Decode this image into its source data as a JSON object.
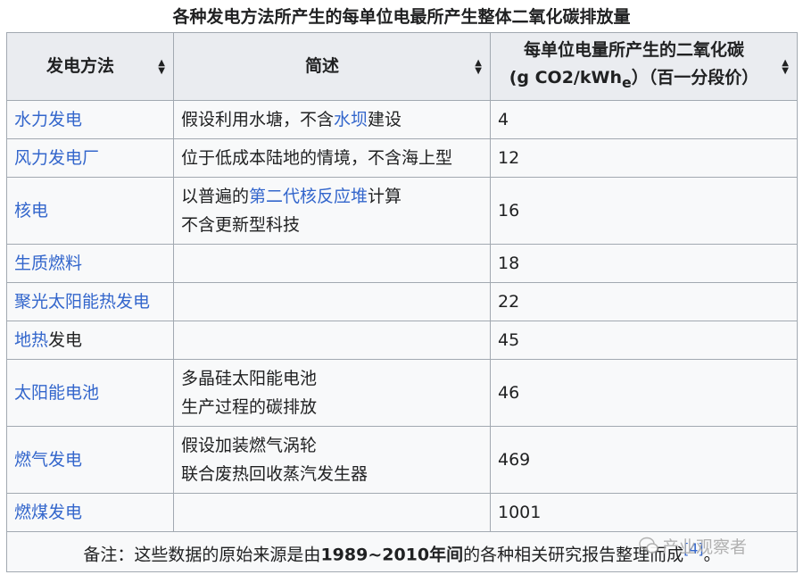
{
  "caption": "各种发电方法所产生的每单位电最所产生整体二氧化碳排放量",
  "headers": {
    "method": "发电方法",
    "description": "简述",
    "emission_line1": "每单位电量所产生的二氧化碳",
    "emission_line2_prefix": "(g CO2/kWh",
    "emission_line2_sub": "e",
    "emission_line2_suffix": "）（百一分段价）"
  },
  "rows": [
    {
      "method": "水力发电",
      "desc_a": "假设利用水塘，不含",
      "desc_link": "水坝",
      "desc_b": "建设",
      "value": "4"
    },
    {
      "method": "风力发电厂",
      "desc_a": "位于低成本陆地的情境，不含海上型",
      "value": "12"
    },
    {
      "method": "核电",
      "desc_a": "以普遍的",
      "desc_link": "第二代核反应堆",
      "desc_b": "计算",
      "desc_line2": "不含更新型科技",
      "value": "16"
    },
    {
      "method": "生质燃料",
      "value": "18"
    },
    {
      "method": "聚光太阳能热发电",
      "value": "22"
    },
    {
      "method_link": "地热",
      "method_rest": "发电",
      "value": "45"
    },
    {
      "method": "太阳能电池",
      "desc_a": "多晶硅太阳能电池",
      "desc_line2": "生产过程的碳排放",
      "value": "46"
    },
    {
      "method": "燃气发电",
      "desc_a": "假设加装燃气涡轮",
      "desc_line2": "联合废热回收蒸汽发生器",
      "value": "469"
    },
    {
      "method": "燃煤发电",
      "value": "1001"
    }
  ],
  "note": {
    "prefix": "备注：这些数据的原始来源是由",
    "bold": "1989~2010年间",
    "suffix": "的各种相关研究报告整理而成",
    "ref": "[4]",
    "end": "。"
  },
  "watermark": "产业观察者",
  "colors": {
    "link": "#3366cc",
    "header_bg": "#eaecf0",
    "cell_bg": "#f8f9fa",
    "border": "#a2a9b1"
  }
}
